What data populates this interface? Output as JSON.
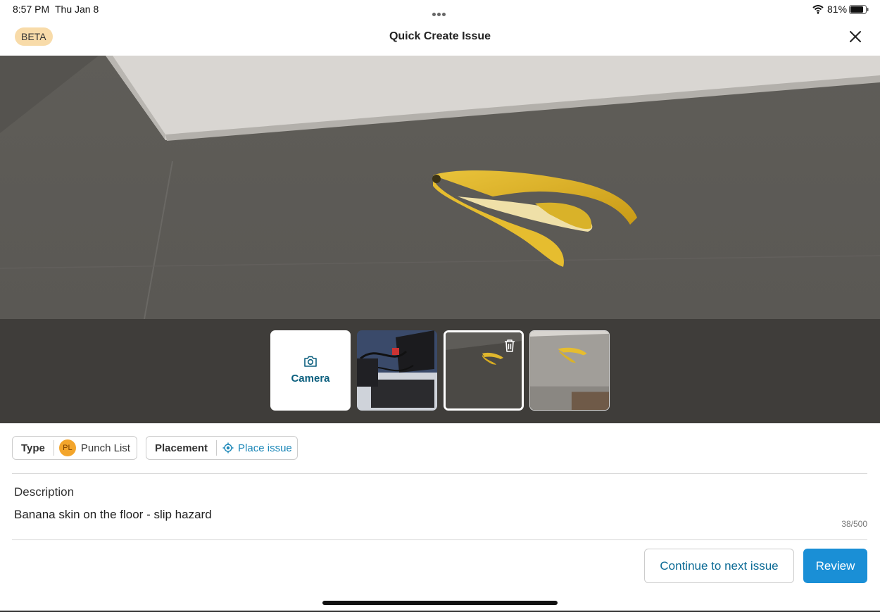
{
  "status_bar": {
    "time": "8:57 PM",
    "date": "Thu Jan 8",
    "battery_percent": "81%",
    "wifi_icon": "wifi-icon",
    "battery_icon": "battery-icon"
  },
  "header": {
    "badge": "BETA",
    "title": "Quick Create Issue",
    "close_icon": "close-icon"
  },
  "photos": {
    "camera_label": "Camera",
    "camera_icon": "camera-icon",
    "delete_icon": "trash-icon",
    "selected_index": 2
  },
  "type": {
    "label": "Type",
    "avatar": "PL",
    "value": "Punch List",
    "avatar_color": "#f3a52b"
  },
  "placement": {
    "label": "Placement",
    "value": "Place issue",
    "icon": "locate-icon"
  },
  "description": {
    "label": "Description",
    "value": "Banana skin on the floor - slip hazard",
    "char_count": "38/500"
  },
  "actions": {
    "continue_label": "Continue to next issue",
    "review_label": "Review",
    "accent": "#1a8fd6"
  }
}
